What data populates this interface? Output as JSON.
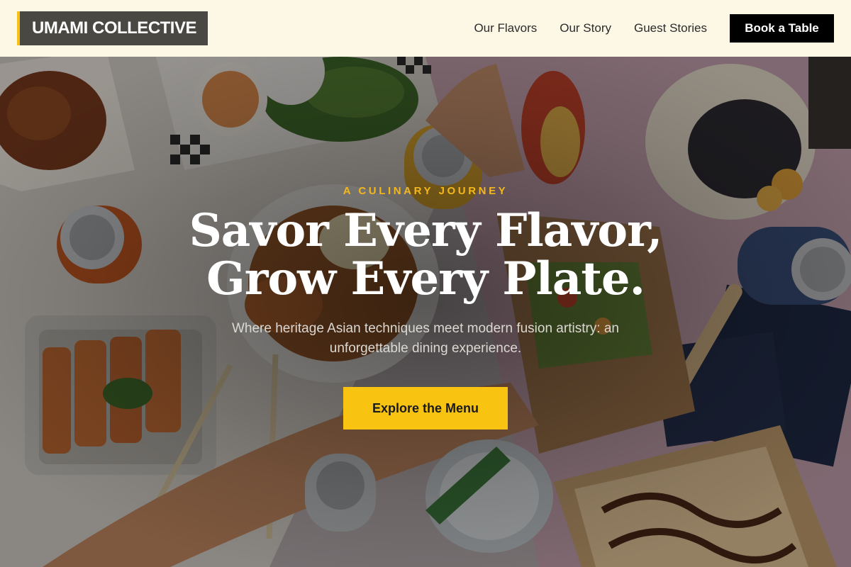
{
  "header": {
    "brand": "UMAMI COLLECTIVE",
    "nav": [
      {
        "label": "Our Flavors"
      },
      {
        "label": "Our Story"
      },
      {
        "label": "Guest Stories"
      }
    ],
    "cta_label": "Book a Table"
  },
  "hero": {
    "eyebrow": "A CULINARY JOURNEY",
    "headline_line1": "Savor Every Flavor,",
    "headline_line2": "Grow Every Plate.",
    "subheading": "Where heritage Asian techniques meet modern fusion artistry: an unforgettable dining experience.",
    "cta_label": "Explore the Menu"
  },
  "colors": {
    "header_bg": "#fdf8e6",
    "logo_bg": "#4a4842",
    "logo_accent": "#f6c21a",
    "accent_yellow": "#f9c311",
    "eyebrow_gold": "#f4b81c",
    "book_button_bg": "#000000"
  }
}
